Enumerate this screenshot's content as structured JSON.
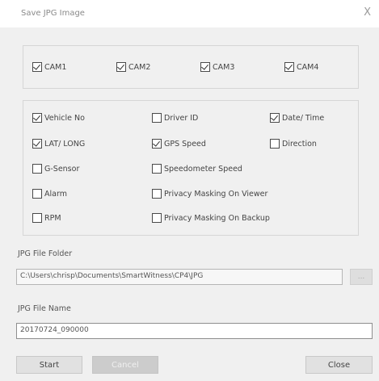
{
  "window": {
    "title": "Save JPG Image",
    "close_glyph": "X"
  },
  "cameras": [
    {
      "label": "CAM1",
      "checked": true
    },
    {
      "label": "CAM2",
      "checked": true
    },
    {
      "label": "CAM3",
      "checked": true
    },
    {
      "label": "CAM4",
      "checked": true
    }
  ],
  "overlay_options": {
    "vehicle_no": {
      "label": "Vehicle No",
      "checked": true
    },
    "driver_id": {
      "label": "Driver ID",
      "checked": false
    },
    "date_time": {
      "label": "Date/ Time",
      "checked": true
    },
    "lat_long": {
      "label": "LAT/ LONG",
      "checked": true
    },
    "gps_speed": {
      "label": "GPS Speed",
      "checked": true
    },
    "direction": {
      "label": "Direction",
      "checked": false
    },
    "g_sensor": {
      "label": "G-Sensor",
      "checked": false
    },
    "speedometer_speed": {
      "label": "Speedometer Speed",
      "checked": false
    },
    "alarm": {
      "label": "Alarm",
      "checked": false
    },
    "privacy_masking_viewer": {
      "label": "Privacy Masking On Viewer",
      "checked": false
    },
    "rpm": {
      "label": "RPM",
      "checked": false
    },
    "privacy_masking_backup": {
      "label": "Privacy Masking On Backup",
      "checked": false
    }
  },
  "jpg_folder": {
    "label": "JPG File Folder",
    "value": "C:\\Users\\chrisp\\Documents\\SmartWitness\\CP4\\JPG",
    "browse_label": "..."
  },
  "jpg_name": {
    "label": "JPG File Name",
    "value": "20170724_090000"
  },
  "buttons": {
    "start": "Start",
    "cancel": "Cancel",
    "close": "Close"
  }
}
